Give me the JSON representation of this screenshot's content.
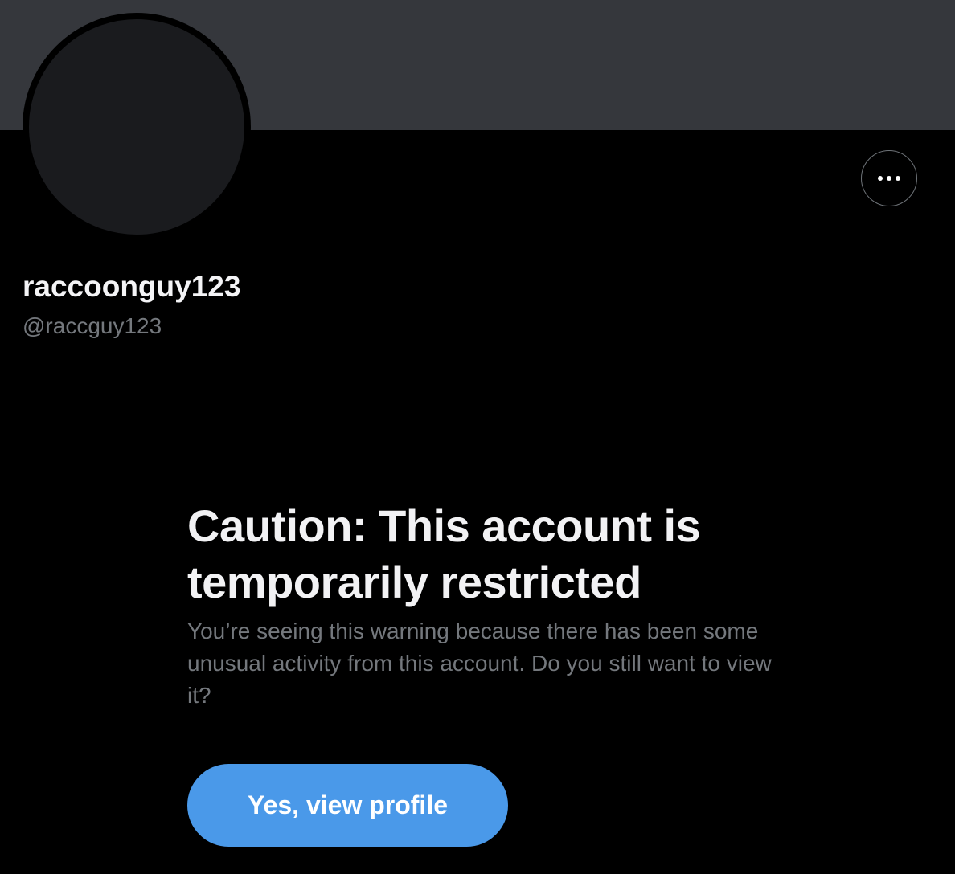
{
  "header": {
    "banner_color": "#35373c",
    "avatar_color": "#1a1b1e",
    "more_icon": "more-horizontal-icon"
  },
  "profile": {
    "display_name": "raccoonguy123",
    "handle": "@raccguy123"
  },
  "warning": {
    "title": "Caution: This account is temporarily restricted",
    "body": "You’re seeing this warning because there has been some unusual activity from this account. Do you still want to view it?",
    "confirm_label": "Yes, view profile",
    "accent_color": "#4a99e9"
  }
}
